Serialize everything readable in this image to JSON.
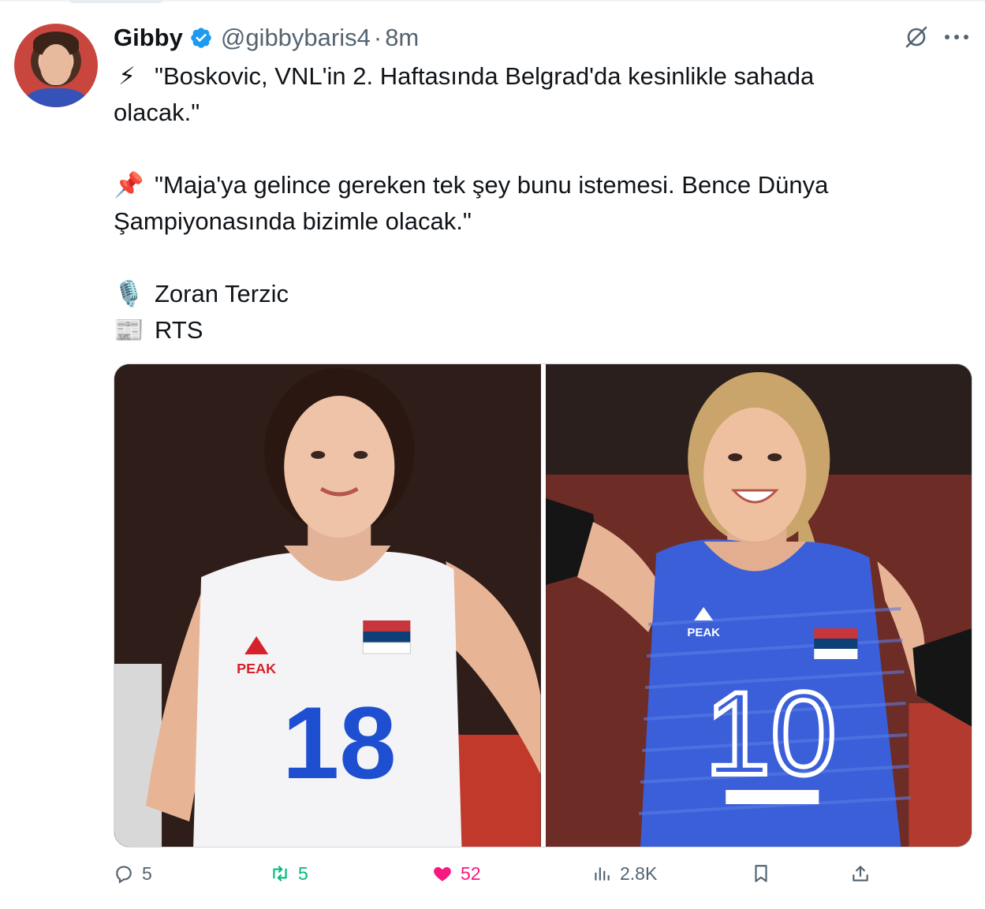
{
  "tweet": {
    "author": {
      "name": "Gibby",
      "handle": "@gibbybaris4",
      "separator": "·",
      "time": "8m",
      "verified": true
    },
    "lines": [
      {
        "emoji": "⚡",
        "emoji_icon": "lightning-icon",
        "text": "\"Boskovic, VNL'in 2. Haftasında Belgrad'da kesinlikle sahada"
      },
      {
        "emoji": "",
        "text": "olacak.\""
      },
      {
        "emoji": "📌",
        "emoji_icon": "pushpin-icon",
        "text": "\"Maja'ya gelince gereken tek şey bunu istemesi. Bence Dünya"
      },
      {
        "emoji": "",
        "text": "Şampiyonasında bizimle olacak.\""
      },
      {
        "emoji": "🎙️",
        "emoji_icon": "microphone-icon",
        "text": "Zoran Terzic"
      },
      {
        "emoji": "📰",
        "emoji_icon": "newspaper-icon",
        "text": "RTS"
      }
    ],
    "media": [
      {
        "jersey_number": "18",
        "brand": "PEAK",
        "country": "SERBIA"
      },
      {
        "jersey_number": "10",
        "brand": "PEAK",
        "country": "SERBIA"
      }
    ],
    "actions": {
      "replies": "5",
      "retweets": "5",
      "likes": "52",
      "views": "2.8K"
    }
  },
  "colors": {
    "text_primary": "#0f1419",
    "text_secondary": "#536471",
    "verified_blue": "#1d9bf0",
    "retweet_green": "#00ba7c",
    "like_pink": "#f91880",
    "jersey_blue": "#1f4fd1",
    "peak_red": "#d6222a"
  }
}
